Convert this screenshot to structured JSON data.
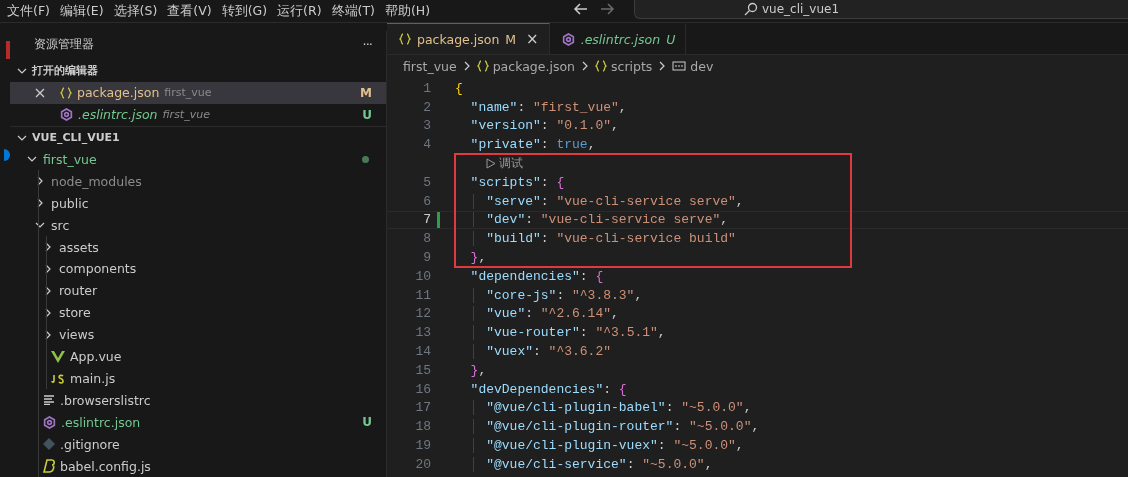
{
  "menu": [
    "文件(F)",
    "编辑(E)",
    "选择(S)",
    "查看(V)",
    "转到(G)",
    "运行(R)",
    "终端(T)",
    "帮助(H)"
  ],
  "search": {
    "value": "vue_cli_vue1"
  },
  "sidebar": {
    "title": "资源管理器",
    "more": "···",
    "open_editors": {
      "title": "打开的编辑器",
      "expanded": true,
      "items": [
        {
          "name": "package.json",
          "folder": "first_vue",
          "badge": "M",
          "kind": "json",
          "modified": true,
          "selected": true,
          "preview": false
        },
        {
          "name": ".eslintrc.json",
          "folder": "first_vue",
          "badge": "U",
          "kind": "eslint",
          "modified": false,
          "selected": false,
          "preview": true
        }
      ]
    },
    "workspace": {
      "title": "VUE_CLI_VUE1",
      "expanded": true,
      "items": [
        {
          "name": "first_vue",
          "kind": "folder",
          "expanded": true,
          "untracked": true,
          "dot": true,
          "children": [
            {
              "name": "node_modules",
              "kind": "folder",
              "expanded": false,
              "ignored": true
            },
            {
              "name": "public",
              "kind": "folder",
              "expanded": false,
              "untracked": false
            },
            {
              "name": "src",
              "kind": "folder",
              "expanded": true,
              "untracked": false,
              "children": [
                {
                  "name": "assets",
                  "kind": "folder",
                  "expanded": false,
                  "untracked": false
                },
                {
                  "name": "components",
                  "kind": "folder",
                  "expanded": false,
                  "untracked": false
                },
                {
                  "name": "router",
                  "kind": "folder",
                  "expanded": false,
                  "untracked": false
                },
                {
                  "name": "store",
                  "kind": "folder",
                  "expanded": false,
                  "untracked": false
                },
                {
                  "name": "views",
                  "kind": "folder",
                  "expanded": false,
                  "untracked": false
                },
                {
                  "name": "App.vue",
                  "kind": "vue",
                  "untracked": false
                },
                {
                  "name": "main.js",
                  "kind": "js",
                  "untracked": false
                }
              ]
            },
            {
              "name": ".browserslistrc",
              "kind": "text",
              "untracked": false
            },
            {
              "name": ".eslintrc.json",
              "kind": "eslint",
              "untracked": true,
              "badge": "U"
            },
            {
              "name": ".gitignore",
              "kind": "git",
              "untracked": false
            },
            {
              "name": "babel.config.js",
              "kind": "babel",
              "untracked": false
            }
          ]
        }
      ]
    }
  },
  "tabs": [
    {
      "name": "package.json",
      "badge": "M",
      "kind": "json",
      "modified": true,
      "selected": true,
      "preview": false,
      "close": "×"
    },
    {
      "name": ".eslintrc.json",
      "badge": "U",
      "kind": "eslint",
      "modified": false,
      "selected": false,
      "preview": true
    }
  ],
  "breadcrumb": [
    {
      "label": "first_vue",
      "kind": "folder"
    },
    {
      "label": "package.json",
      "kind": "json"
    },
    {
      "label": "scripts",
      "kind": "json"
    },
    {
      "label": "dev",
      "kind": "key"
    }
  ],
  "code": [
    {
      "boxed": false,
      "lines": [
        {
          "number": "1",
          "tokens": [
            {
              "kind": "open",
              "text": "{"
            }
          ]
        },
        {
          "number": "2",
          "tokens": [
            {
              "kind": "key",
              "text": "\"name\""
            },
            {
              "kind": "punct",
              "text": ": "
            },
            {
              "kind": "string",
              "text": "\"first_vue\""
            },
            {
              "kind": "punct",
              "text": ","
            }
          ]
        },
        {
          "number": "3",
          "tokens": [
            {
              "kind": "key",
              "text": "\"version\""
            },
            {
              "kind": "punct",
              "text": ": "
            },
            {
              "kind": "string",
              "text": "\"0.1.0\""
            },
            {
              "kind": "punct",
              "text": ","
            }
          ]
        },
        {
          "number": "4",
          "tokens": [
            {
              "kind": "key",
              "text": "\"private\""
            },
            {
              "kind": "punct",
              "text": ": "
            },
            {
              "kind": "bool",
              "text": "true"
            },
            {
              "kind": "punct",
              "text": ","
            }
          ]
        }
      ]
    },
    {
      "boxed": true,
      "lines": [
        {
          "kind": "codelens",
          "label": "调试"
        },
        {
          "number": "5",
          "tokens": [
            {
              "kind": "key",
              "text": "\"scripts\""
            },
            {
              "kind": "punct",
              "text": ": "
            },
            {
              "kind": "open",
              "text": "{"
            }
          ]
        },
        {
          "number": "6",
          "tokens": [
            {
              "kind": "key",
              "text": "\"serve\""
            },
            {
              "kind": "punct",
              "text": ": "
            },
            {
              "kind": "string",
              "text": "\"vue-cli-service serve\""
            },
            {
              "kind": "punct",
              "text": ","
            }
          ]
        },
        {
          "number": "7",
          "current": true,
          "changed": true,
          "tokens": [
            {
              "kind": "key",
              "text": "\"dev\""
            },
            {
              "kind": "punct",
              "text": ": "
            },
            {
              "kind": "string",
              "text": "\"vue-cli-service serve\""
            },
            {
              "kind": "punct",
              "text": ","
            }
          ]
        },
        {
          "number": "8",
          "tokens": [
            {
              "kind": "key",
              "text": "\"build\""
            },
            {
              "kind": "punct",
              "text": ": "
            },
            {
              "kind": "string",
              "text": "\"vue-cli-service build\""
            }
          ]
        },
        {
          "number": "9",
          "tokens": [
            {
              "kind": "close",
              "text": "}"
            },
            {
              "kind": "punct",
              "text": ","
            }
          ]
        }
      ]
    },
    {
      "boxed": false,
      "lines": [
        {
          "number": "10",
          "tokens": [
            {
              "kind": "key",
              "text": "\"dependencies\""
            },
            {
              "kind": "punct",
              "text": ": "
            },
            {
              "kind": "open",
              "text": "{"
            }
          ]
        },
        {
          "number": "11",
          "tokens": [
            {
              "kind": "key",
              "text": "\"core-js\""
            },
            {
              "kind": "punct",
              "text": ": "
            },
            {
              "kind": "string",
              "text": "\"^3.8.3\""
            },
            {
              "kind": "punct",
              "text": ","
            }
          ]
        },
        {
          "number": "12",
          "tokens": [
            {
              "kind": "key",
              "text": "\"vue\""
            },
            {
              "kind": "punct",
              "text": ": "
            },
            {
              "kind": "string",
              "text": "\"^2.6.14\""
            },
            {
              "kind": "punct",
              "text": ","
            }
          ]
        },
        {
          "number": "13",
          "tokens": [
            {
              "kind": "key",
              "text": "\"vue-router\""
            },
            {
              "kind": "punct",
              "text": ": "
            },
            {
              "kind": "string",
              "text": "\"^3.5.1\""
            },
            {
              "kind": "punct",
              "text": ","
            }
          ]
        },
        {
          "number": "14",
          "tokens": [
            {
              "kind": "key",
              "text": "\"vuex\""
            },
            {
              "kind": "punct",
              "text": ": "
            },
            {
              "kind": "string",
              "text": "\"^3.6.2\""
            }
          ]
        },
        {
          "number": "15",
          "tokens": [
            {
              "kind": "close",
              "text": "}"
            },
            {
              "kind": "punct",
              "text": ","
            }
          ]
        },
        {
          "number": "16",
          "tokens": [
            {
              "kind": "key",
              "text": "\"devDependencies\""
            },
            {
              "kind": "punct",
              "text": ": "
            },
            {
              "kind": "open",
              "text": "{"
            }
          ]
        },
        {
          "number": "17",
          "tokens": [
            {
              "kind": "key",
              "text": "\"@vue/cli-plugin-babel\""
            },
            {
              "kind": "punct",
              "text": ": "
            },
            {
              "kind": "string",
              "text": "\"~5.0.0\""
            },
            {
              "kind": "punct",
              "text": ","
            }
          ]
        },
        {
          "number": "18",
          "tokens": [
            {
              "kind": "key",
              "text": "\"@vue/cli-plugin-router\""
            },
            {
              "kind": "punct",
              "text": ": "
            },
            {
              "kind": "string",
              "text": "\"~5.0.0\""
            },
            {
              "kind": "punct",
              "text": ","
            }
          ]
        },
        {
          "number": "19",
          "tokens": [
            {
              "kind": "key",
              "text": "\"@vue/cli-plugin-vuex\""
            },
            {
              "kind": "punct",
              "text": ": "
            },
            {
              "kind": "string",
              "text": "\"~5.0.0\""
            },
            {
              "kind": "punct",
              "text": ","
            }
          ]
        },
        {
          "number": "20",
          "tokens": [
            {
              "kind": "key",
              "text": "\"@vue/cli-service\""
            },
            {
              "kind": "punct",
              "text": ": "
            },
            {
              "kind": "string",
              "text": "\"~5.0.0\""
            },
            {
              "kind": "punct",
              "text": ","
            }
          ]
        }
      ]
    }
  ]
}
